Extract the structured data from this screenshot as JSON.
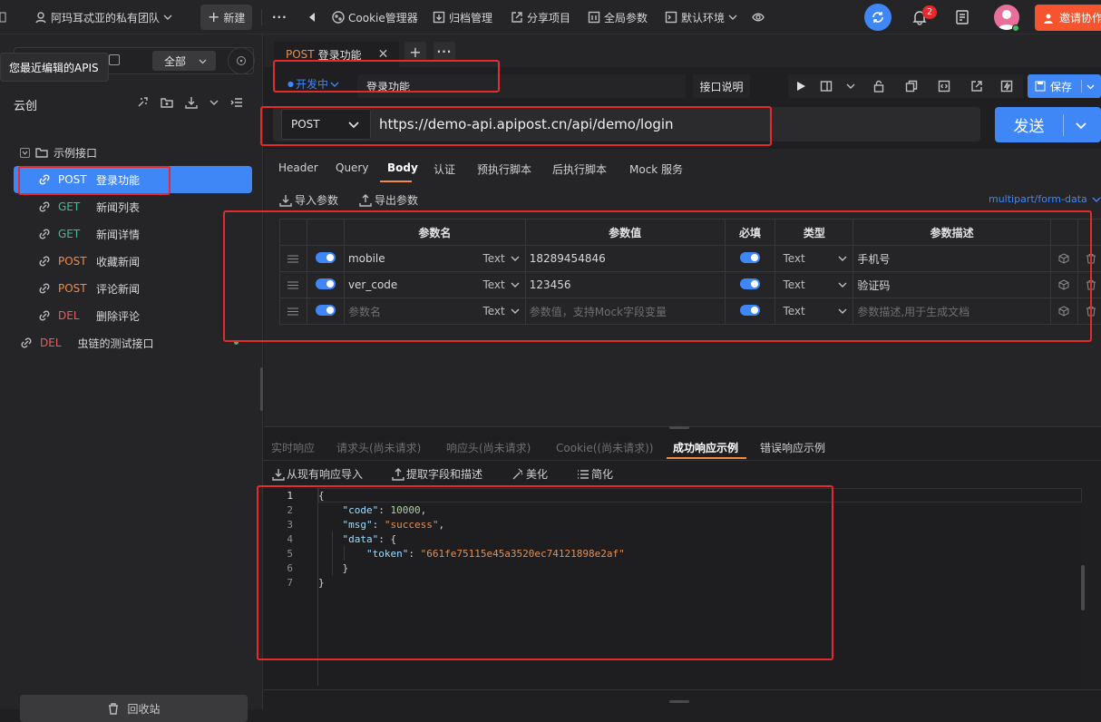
{
  "topbar": {
    "team_name": "阿玛耳忒亚的私有团队",
    "new_label": "新建",
    "cookie_label": "Cookie管理器",
    "archive_label": "归档管理",
    "share_label": "分享项目",
    "global_params_label": "全局参数",
    "env_label": "默认环境",
    "notification_count": "2",
    "invite_label": "邀请协作"
  },
  "sidebar": {
    "tooltip": "您最近编辑的APIS",
    "filter_value": "全部",
    "project_name": "云创",
    "folder_name": "示例接口",
    "items": [
      {
        "method": "POST",
        "name": "登录功能"
      },
      {
        "method": "GET",
        "name": "新闻列表"
      },
      {
        "method": "GET",
        "name": "新闻详情"
      },
      {
        "method": "POST",
        "name": "收藏新闻"
      },
      {
        "method": "POST",
        "name": "评论新闻"
      },
      {
        "method": "DEL",
        "name": "删除评论"
      }
    ],
    "extra_item": {
      "method": "DEL",
      "name": "虫链的测试接口"
    },
    "recycle_label": "回收站"
  },
  "tabbar": {
    "tab_method": "POST",
    "tab_name": "登录功能"
  },
  "request": {
    "status": "开发中",
    "name": "登录功能",
    "doc_button": "接口说明",
    "save_label": "保存",
    "method": "POST",
    "url": "https://demo-api.apipost.cn/api/demo/login",
    "send_label": "发送"
  },
  "req_tabs": [
    "Header",
    "Query",
    "Body",
    "认证",
    "预执行脚本",
    "后执行脚本",
    "Mock 服务"
  ],
  "body": {
    "import_label": "导入参数",
    "export_label": "导出参数",
    "content_type": "multipart/form-data",
    "headers": [
      "参数名",
      "参数值",
      "必填",
      "类型",
      "参数描述"
    ],
    "rows": [
      {
        "name": "mobile",
        "kind": "Text",
        "value": "18289454846",
        "type": "Text",
        "desc": "手机号"
      },
      {
        "name": "ver_code",
        "kind": "Text",
        "value": "123456",
        "type": "Text",
        "desc": "验证码"
      }
    ],
    "placeholder_row": {
      "name": "参数名",
      "kind": "Text",
      "value": "参数值，支持Mock字段变量",
      "type": "Text",
      "desc": "参数描述,用于生成文档"
    }
  },
  "resp_tabs": [
    "实时响应",
    "请求头(尚未请求)",
    "响应头(尚未请求)",
    "Cookie((尚未请求))",
    "成功响应示例",
    "错误响应示例"
  ],
  "resp_tools": {
    "import_label": "从现有响应导入",
    "extract_label": "提取字段和描述",
    "beautify_label": "美化",
    "simplify_label": "简化"
  },
  "response_example": {
    "line_numbers": [
      "1",
      "2",
      "3",
      "4",
      "5",
      "6",
      "7"
    ],
    "code": 10000,
    "msg": "success",
    "token": "661fe75115e45a3520ec74121898e2af"
  },
  "colors": {
    "accent": "#3f86f6",
    "highlight_box": "#e5292d",
    "invite": "#f5542e"
  }
}
